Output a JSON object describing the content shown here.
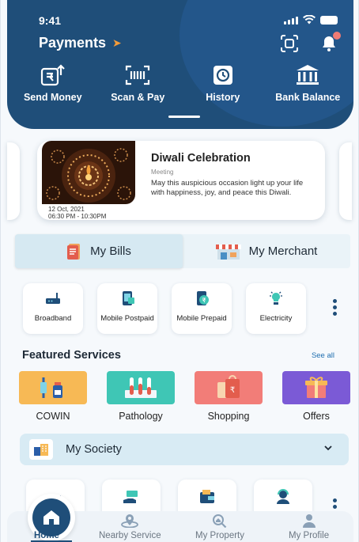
{
  "status_bar": {
    "time": "9:41"
  },
  "header": {
    "title": "Payments",
    "actions": [
      {
        "label": "Send Money",
        "icon": "send-money-icon"
      },
      {
        "label": "Scan & Pay",
        "icon": "scan-pay-icon"
      },
      {
        "label": "History",
        "icon": "history-icon"
      },
      {
        "label": "Bank Balance",
        "icon": "bank-icon"
      }
    ]
  },
  "event": {
    "title": "Diwali Celebration",
    "type": "Meeting",
    "description": "May this auspicious occasion light up your life with happiness, joy, and peace this Diwali.",
    "date": "12 Oct, 2021",
    "time": "06:30 PM - 10:30PM"
  },
  "tabs": {
    "bills": "My Bills",
    "merchant": "My Merchant"
  },
  "bill_services": [
    {
      "label": "Broadband",
      "icon": "router-icon"
    },
    {
      "label": "Mobile Postpaid",
      "icon": "mobile-postpaid-icon"
    },
    {
      "label": "Mobile Prepaid",
      "icon": "mobile-prepaid-icon"
    },
    {
      "label": "Electricity",
      "icon": "bulb-icon"
    }
  ],
  "featured": {
    "title": "Featured Services",
    "see_all": "See all",
    "items": [
      {
        "label": "COWIN",
        "color": "#f7b955"
      },
      {
        "label": "Pathology",
        "color": "#3fc6b5"
      },
      {
        "label": "Shopping",
        "color": "#f27d78"
      },
      {
        "label": "Offers",
        "color": "#7b5ad6"
      }
    ]
  },
  "society": {
    "label": "My Society"
  },
  "bottom_nav": {
    "home": "Home",
    "nearby": "Nearby Service",
    "property": "My Property",
    "profile": "My Profile"
  },
  "colors": {
    "primary": "#1f4e79",
    "accent": "#f29b3a"
  }
}
